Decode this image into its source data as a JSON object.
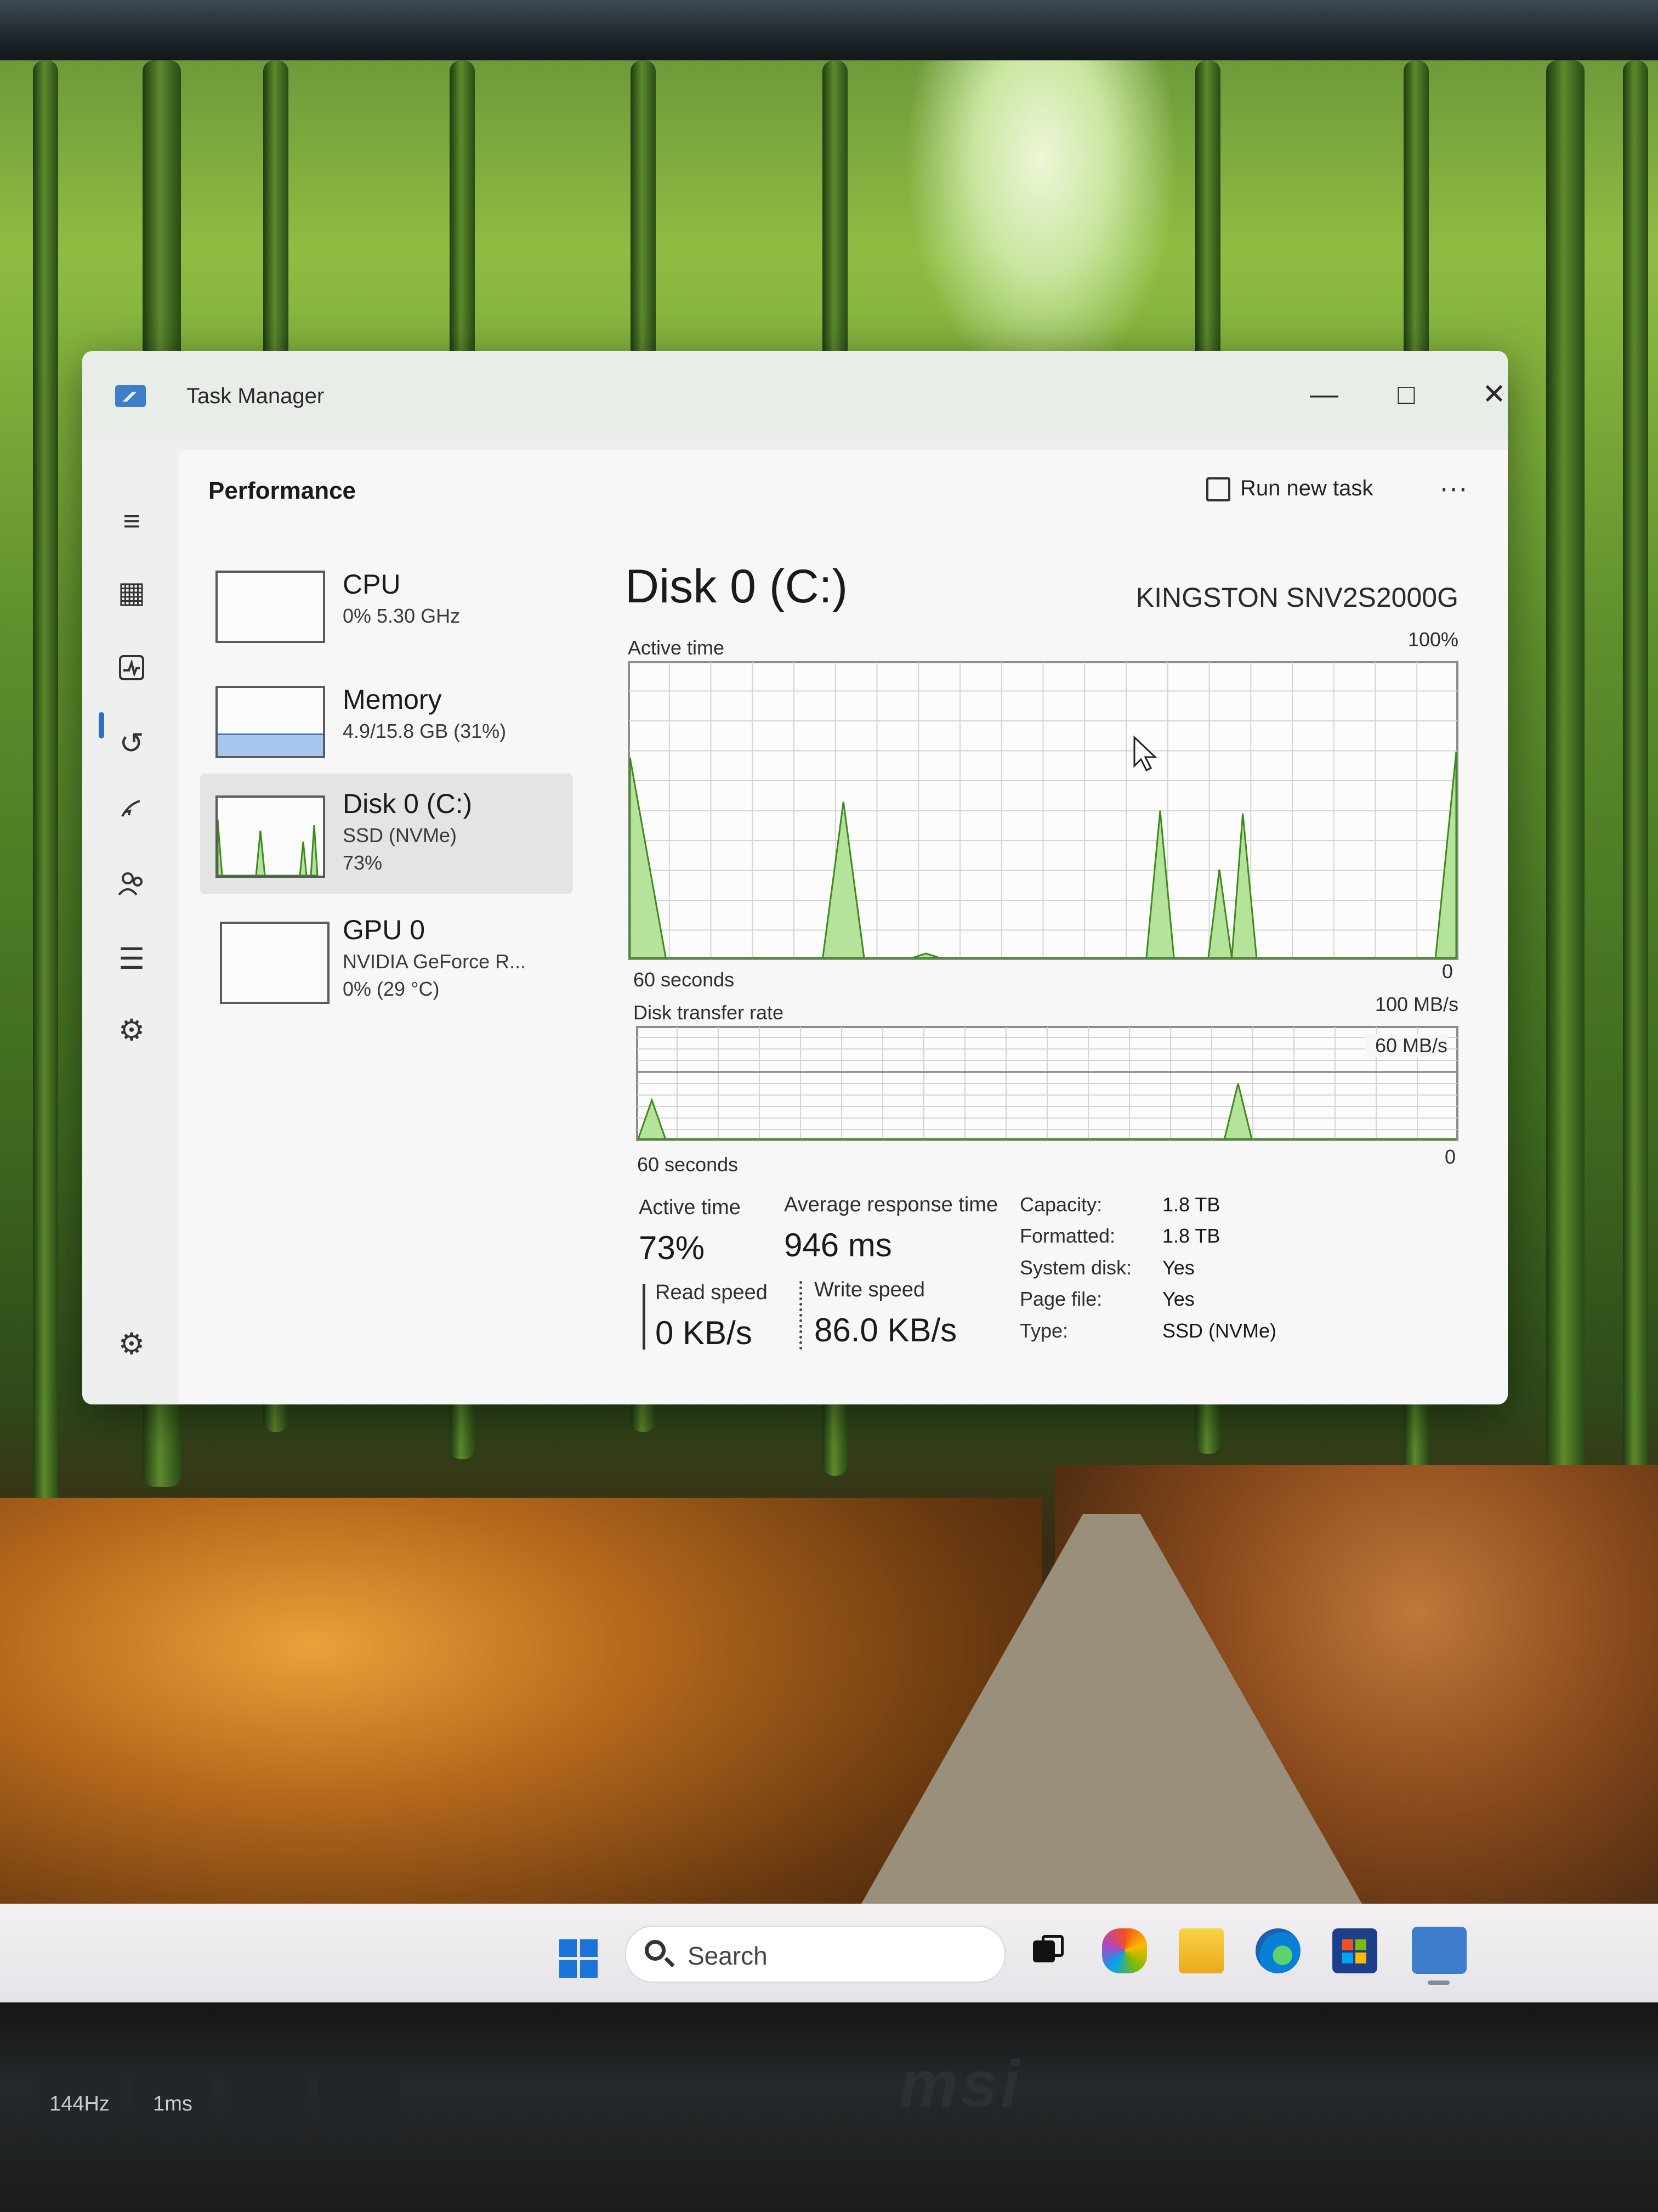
{
  "window": {
    "title": "Task Manager",
    "minimize": "—",
    "maximize": "□",
    "close": "✕"
  },
  "header": {
    "page_title": "Performance",
    "run_new_task": "Run new task",
    "more": "···"
  },
  "nav": [
    {
      "icon": "menu-icon"
    },
    {
      "icon": "processes-icon"
    },
    {
      "icon": "performance-icon",
      "selected": true
    },
    {
      "icon": "app-history-icon"
    },
    {
      "icon": "startup-apps-icon"
    },
    {
      "icon": "users-icon"
    },
    {
      "icon": "details-icon"
    },
    {
      "icon": "services-icon"
    },
    {
      "icon": "settings-icon"
    }
  ],
  "devices": [
    {
      "name": "CPU",
      "line1": "0% 5.30 GHz",
      "line2": ""
    },
    {
      "name": "Memory",
      "line1": "4.9/15.8 GB (31%)",
      "line2": ""
    },
    {
      "name": "Disk 0 (C:)",
      "line1": "SSD (NVMe)",
      "line2": "73%"
    },
    {
      "name": "GPU 0",
      "line1": "NVIDIA GeForce R...",
      "line2": "0% (29 °C)"
    }
  ],
  "detail": {
    "title": "Disk 0 (C:)",
    "model": "KINGSTON SNV2S2000G",
    "graph1": {
      "label": "Active time",
      "max": "100%",
      "span": "60 seconds",
      "min": "0"
    },
    "graph2": {
      "label": "Disk transfer rate",
      "max": "100 MB/s",
      "mid": "60 MB/s",
      "span": "60 seconds",
      "min": "0"
    },
    "stats": {
      "active_time_label": "Active time",
      "active_time_value": "73%",
      "avg_resp_label": "Average response time",
      "avg_resp_value": "946 ms",
      "read_label": "Read speed",
      "read_value": "0 KB/s",
      "write_label": "Write speed",
      "write_value": "86.0 KB/s"
    },
    "props": [
      {
        "k": "Capacity:",
        "v": "1.8 TB"
      },
      {
        "k": "Formatted:",
        "v": "1.8 TB"
      },
      {
        "k": "System disk:",
        "v": "Yes"
      },
      {
        "k": "Page file:",
        "v": "Yes"
      },
      {
        "k": "Type:",
        "v": "SSD (NVMe)"
      }
    ]
  },
  "chart_data": [
    {
      "type": "area",
      "title": "Active time",
      "ylim": [
        0,
        100
      ],
      "x_span": "60 seconds",
      "series": [
        {
          "values": [
            100,
            2,
            0,
            0,
            0,
            0,
            0,
            0,
            0,
            0,
            0,
            0,
            0,
            0,
            0,
            0,
            0,
            0,
            0,
            0,
            0,
            0,
            0,
            0,
            0,
            0,
            0,
            0,
            0,
            0,
            0,
            0,
            0,
            0,
            0,
            0,
            0,
            0,
            0,
            0,
            0,
            0,
            0,
            0,
            0,
            0,
            0,
            0,
            0,
            0,
            0,
            0,
            0,
            0,
            0,
            0,
            0,
            0,
            0,
            0
          ]
        }
      ],
      "peaks": [
        [
          0,
          68
        ],
        [
          2.6,
          0
        ],
        [
          14,
          0
        ],
        [
          15.5,
          53
        ],
        [
          17,
          0
        ],
        [
          20.5,
          0
        ],
        [
          21.5,
          1.5
        ],
        [
          22.5,
          0
        ],
        [
          37.5,
          0
        ],
        [
          38.5,
          50
        ],
        [
          39.5,
          0
        ],
        [
          42,
          0
        ],
        [
          42.8,
          30
        ],
        [
          43.7,
          0
        ],
        [
          43.7,
          0
        ],
        [
          44.5,
          49
        ],
        [
          45.5,
          0
        ],
        [
          58.5,
          0
        ],
        [
          60,
          70
        ]
      ]
    },
    {
      "type": "area",
      "title": "Disk transfer rate",
      "ylim": [
        0,
        100
      ],
      "unit": "MB/s",
      "x_span": "60 seconds",
      "peaks": [
        [
          0,
          0
        ],
        [
          1,
          35
        ],
        [
          2,
          0
        ],
        [
          43,
          0
        ],
        [
          44,
          50
        ],
        [
          45,
          0
        ]
      ]
    }
  ],
  "taskbar": {
    "search_placeholder": "Search",
    "apps": [
      "task-view-icon",
      "copilot-icon",
      "file-explorer-icon",
      "edge-icon",
      "store-icon",
      "task-manager-icon"
    ]
  },
  "monitor": {
    "brand": "msi",
    "osd": [
      "144Hz",
      "1ms",
      "",
      ""
    ]
  },
  "colors": {
    "graph_fill": "#b6e39a",
    "graph_stroke": "#3f8a1e",
    "grid": "#d2d6d2",
    "accent": "#2f6fc0"
  }
}
